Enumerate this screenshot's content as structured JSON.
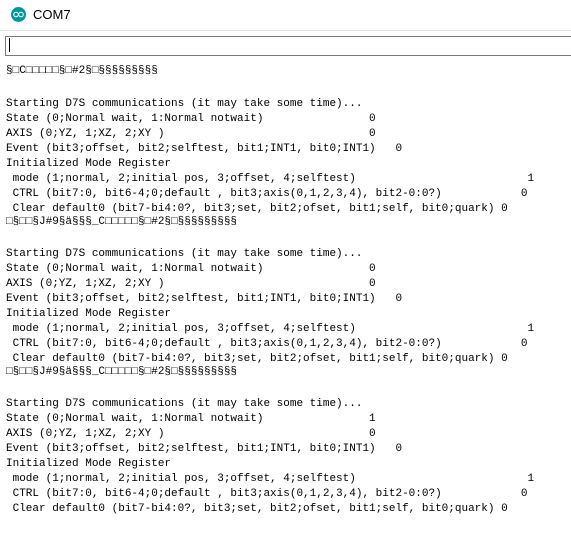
{
  "window": {
    "title": "COM7",
    "app_icon": "arduino-icon",
    "accent": "#00979c"
  },
  "input": {
    "value": "",
    "placeholder": ""
  },
  "output_lines": [
    "§□C□□□□□§□#2§□§§§§§§§§§",
    "",
    "Starting D7S communications (it may take some time)...",
    "State (0;Normal wait, 1:Normal notwait)                0",
    "AXIS (0;YZ, 1;XZ, 2;XY )                               0",
    "Event (bit3;offset, bit2;selftest, bit1;INT1, bit0;INT1)   0",
    "Initialized Mode Register",
    " mode (1;normal, 2;initial pos, 3;offset, 4;selftest)                          1",
    " CTRL (bit7:0, bit6-4;0;default , bit3;axis(0,1,2,3,4), bit2-0:0?)            0",
    " Clear default0 (bit7-bi4:0?, bit3;set, bit2;ofset, bit1;self, bit0;quark) 0",
    "□§□□§J#9§ä§§§_C□□□□□§□#2§□§§§§§§§§§",
    "",
    "Starting D7S communications (it may take some time)...",
    "State (0;Normal wait, 1:Normal notwait)                0",
    "AXIS (0;YZ, 1;XZ, 2;XY )                               0",
    "Event (bit3;offset, bit2;selftest, bit1;INT1, bit0;INT1)   0",
    "Initialized Mode Register",
    " mode (1;normal, 2;initial pos, 3;offset, 4;selftest)                          1",
    " CTRL (bit7:0, bit6-4;0;default , bit3;axis(0,1,2,3,4), bit2-0:0?)            0",
    " Clear default0 (bit7-bi4:0?, bit3;set, bit2;ofset, bit1;self, bit0;quark) 0",
    "□§□□§J#9§ä§§§_C□□□□□§□#2§□§§§§§§§§§",
    "",
    "Starting D7S communications (it may take some time)...",
    "State (0;Normal wait, 1:Normal notwait)                1",
    "AXIS (0;YZ, 1;XZ, 2;XY )                               0",
    "Event (bit3;offset, bit2;selftest, bit1;INT1, bit0;INT1)   0",
    "Initialized Mode Register",
    " mode (1;normal, 2;initial pos, 3;offset, 4;selftest)                          1",
    " CTRL (bit7:0, bit6-4;0;default , bit3;axis(0,1,2,3,4), bit2-0:0?)            0",
    " Clear default0 (bit7-bi4:0?, bit3;set, bit2;ofset, bit1;self, bit0;quark) 0"
  ]
}
